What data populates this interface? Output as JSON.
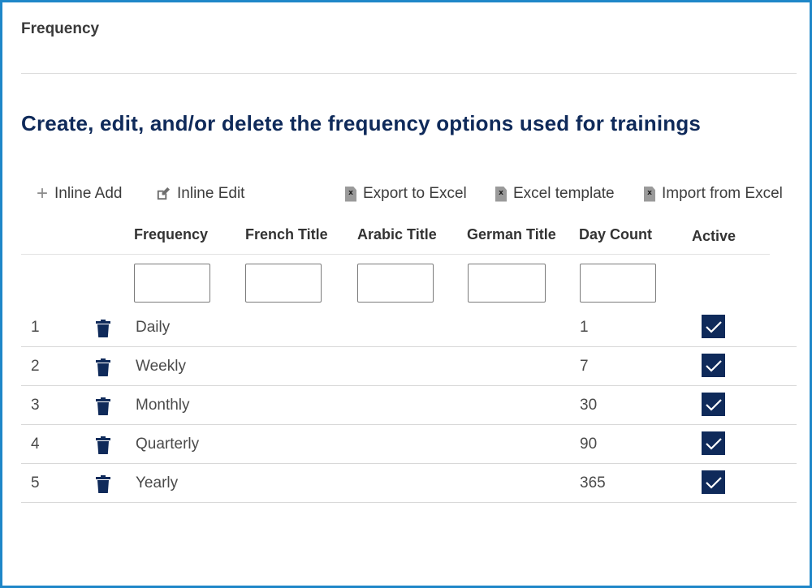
{
  "header": {
    "title": "Frequency"
  },
  "page": {
    "heading": "Create, edit, and/or delete the frequency options used for trainings"
  },
  "toolbar": {
    "inline_add": "Inline Add",
    "inline_edit": "Inline Edit",
    "export_excel": "Export to Excel",
    "excel_template": "Excel template",
    "import_excel": "Import from Excel"
  },
  "table": {
    "columns": {
      "frequency": "Frequency",
      "french": "French Title",
      "arabic": "Arabic Title",
      "german": "German Title",
      "day_count": "Day Count",
      "active": "Active"
    },
    "filters": {
      "frequency": "",
      "french": "",
      "arabic": "",
      "german": "",
      "day_count": ""
    },
    "rows": [
      {
        "num": "1",
        "frequency": "Daily",
        "french": "",
        "arabic": "",
        "german": "",
        "day_count": "1",
        "active": true
      },
      {
        "num": "2",
        "frequency": "Weekly",
        "french": "",
        "arabic": "",
        "german": "",
        "day_count": "7",
        "active": true
      },
      {
        "num": "3",
        "frequency": "Monthly",
        "french": "",
        "arabic": "",
        "german": "",
        "day_count": "30",
        "active": true
      },
      {
        "num": "4",
        "frequency": "Quarterly",
        "french": "",
        "arabic": "",
        "german": "",
        "day_count": "90",
        "active": true
      },
      {
        "num": "5",
        "frequency": "Yearly",
        "french": "",
        "arabic": "",
        "german": "",
        "day_count": "365",
        "active": true
      }
    ]
  },
  "colors": {
    "frame_border": "#1f87c8",
    "accent": "#0f2a5a"
  },
  "icons": {
    "add": "plus-icon",
    "edit": "pencil-edit-icon",
    "export": "excel-file-icon",
    "template": "excel-file-icon",
    "import": "excel-file-icon",
    "delete": "trash-icon",
    "active": "checkbox-checked-icon"
  }
}
